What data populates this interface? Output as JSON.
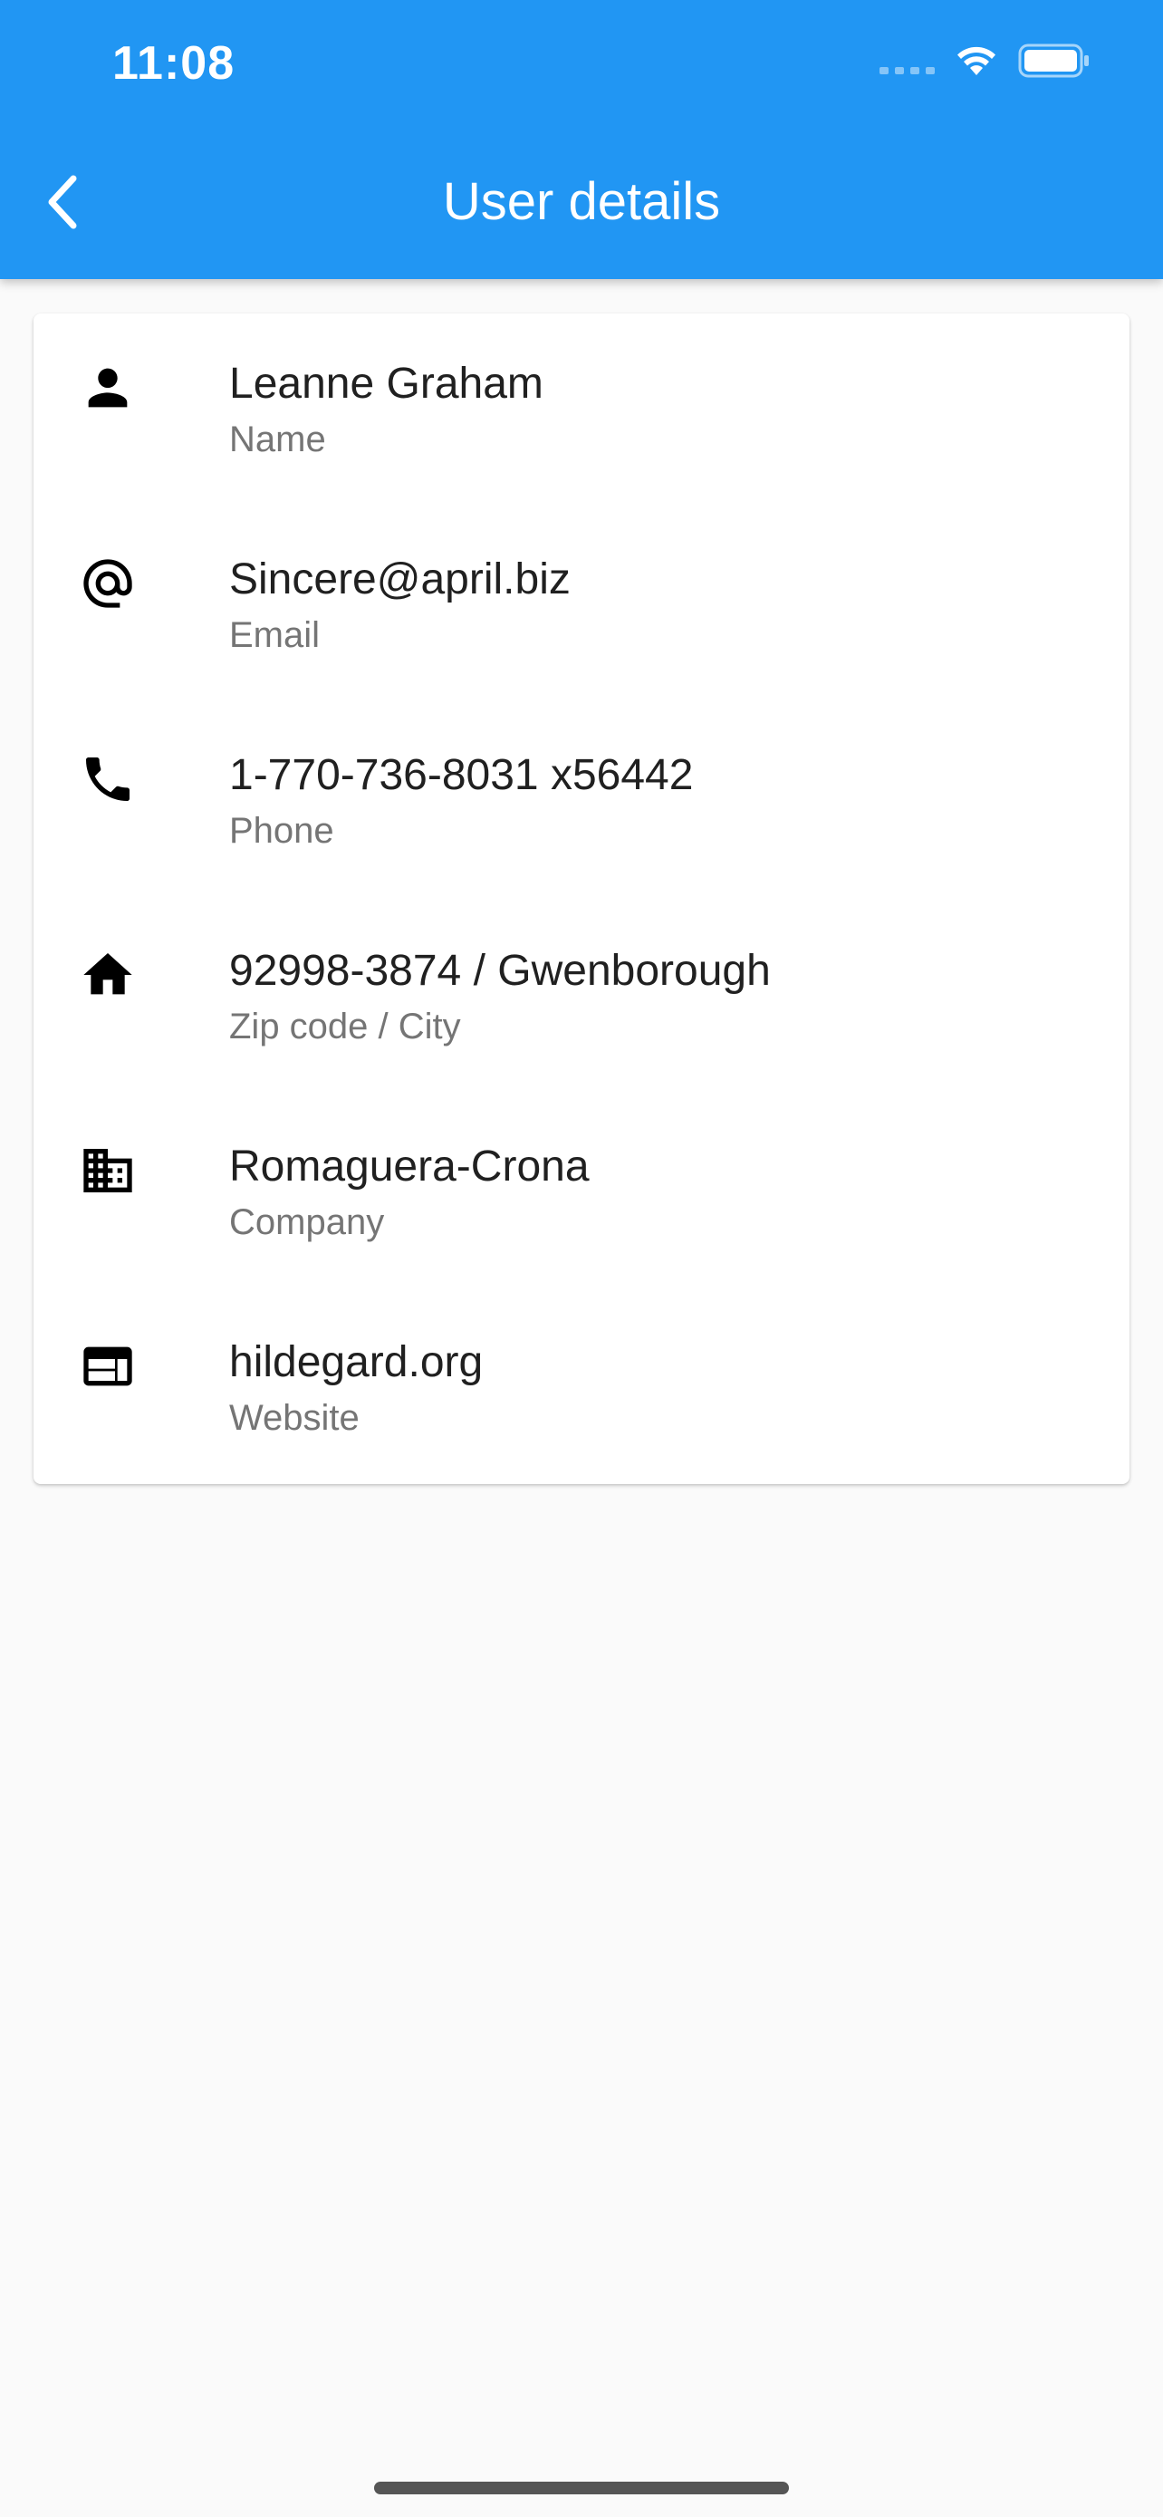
{
  "status_bar": {
    "time": "11:08"
  },
  "app_bar": {
    "title": "User details",
    "back_icon": "chevron-left-icon",
    "color": "#2196f3"
  },
  "details": [
    {
      "icon": "person-icon",
      "value": "Leanne Graham",
      "label": "Name"
    },
    {
      "icon": "at-icon",
      "value": "Sincere@april.biz",
      "label": "Email"
    },
    {
      "icon": "phone-icon",
      "value": "1-770-736-8031 x56442",
      "label": "Phone"
    },
    {
      "icon": "home-icon",
      "value": "92998-3874 / Gwenborough",
      "label": "Zip code / City"
    },
    {
      "icon": "business-icon",
      "value": "Romaguera-Crona",
      "label": "Company"
    },
    {
      "icon": "web-icon",
      "value": "hildegard.org",
      "label": "Website"
    }
  ]
}
